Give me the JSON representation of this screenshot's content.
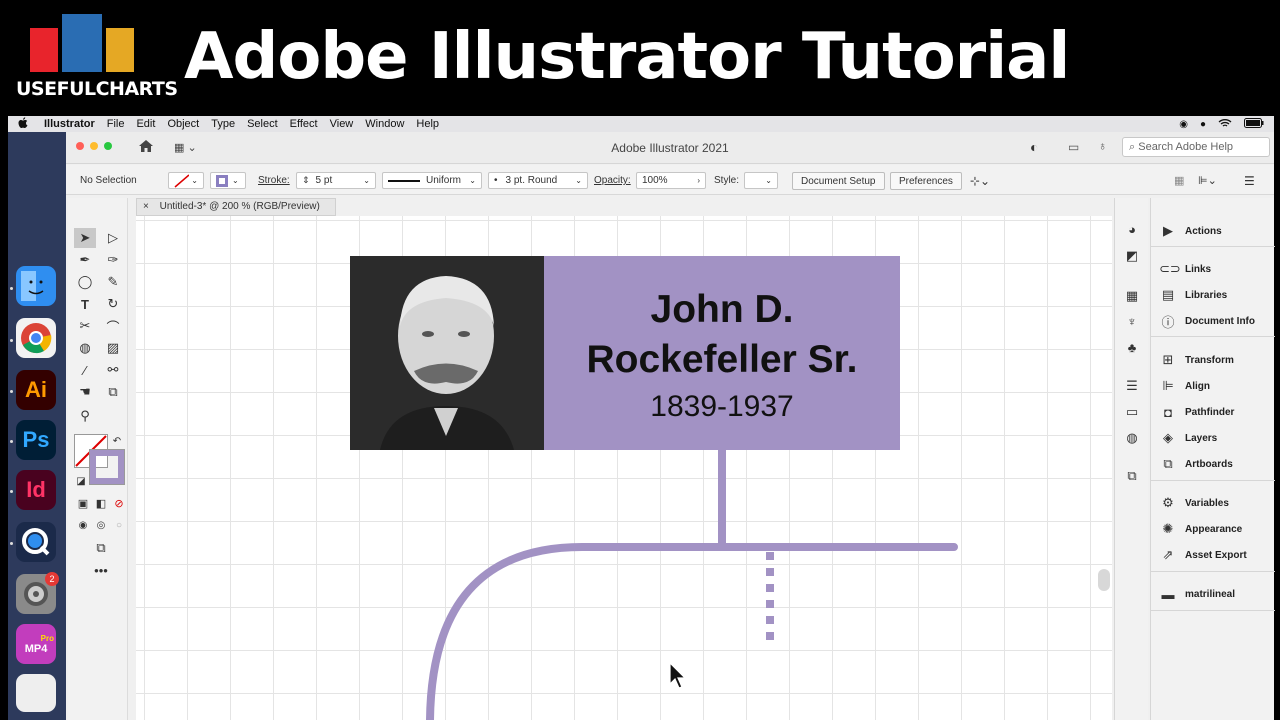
{
  "banner": {
    "logo_text": "USEFULCHARTS",
    "title": "Adobe Illustrator Tutorial",
    "logo_colors": [
      "#e8242c",
      "#2a6db3",
      "#e5a824"
    ]
  },
  "menubar": {
    "apple": "",
    "items": [
      "Illustrator",
      "File",
      "Edit",
      "Object",
      "Type",
      "Select",
      "Effect",
      "View",
      "Window",
      "Help"
    ]
  },
  "dock": {
    "apps": [
      {
        "name": "Finder",
        "icon": "finder-icon",
        "color": "#2f8ef0"
      },
      {
        "name": "Chrome",
        "icon": "chrome-icon",
        "color": "#f2f2f2"
      },
      {
        "name": "Ai",
        "icon": "illustrator-icon",
        "color": "#330000"
      },
      {
        "name": "Ps",
        "icon": "photoshop-icon",
        "color": "#001e36"
      },
      {
        "name": "Id",
        "icon": "indesign-icon",
        "color": "#49021f"
      },
      {
        "name": "QuickTime",
        "icon": "quicktime-icon",
        "color": "#1b2a4a"
      },
      {
        "name": "System Preferences",
        "icon": "gear-icon",
        "color": "#8a8a8a",
        "badge": "2"
      },
      {
        "name": "MP4",
        "icon": "mp4-icon",
        "color": "#c23dbd",
        "sublabel": "Pro"
      },
      {
        "name": "Document",
        "icon": "document-icon",
        "color": "#eeeeee"
      }
    ]
  },
  "window": {
    "title": "Adobe Illustrator 2021",
    "search_placeholder": "Search Adobe Help"
  },
  "controlbar": {
    "selection": "No Selection",
    "stroke_label": "Stroke:",
    "stroke_value": "5 pt",
    "profile": "Uniform",
    "brush": "3 pt. Round",
    "opacity_label": "Opacity:",
    "opacity_value": "100%",
    "style_label": "Style:",
    "document_setup": "Document Setup",
    "preferences": "Preferences"
  },
  "document_tab": {
    "label": "Untitled-3* @ 200 % (RGB/Preview)",
    "close": "×"
  },
  "artwork": {
    "name_line1": "John D.",
    "name_line2": "Rockefeller Sr.",
    "dates": "1839-1937",
    "card_color": "#a292c4",
    "line_color": "#a292c4"
  },
  "panels": [
    {
      "label": "Actions",
      "icon": "play-icon"
    },
    {
      "label": "Links",
      "icon": "link-icon"
    },
    {
      "label": "Libraries",
      "icon": "libraries-icon"
    },
    {
      "label": "Document Info",
      "icon": "info-icon"
    },
    {
      "label": "Transform",
      "icon": "transform-icon"
    },
    {
      "label": "Align",
      "icon": "align-icon"
    },
    {
      "label": "Pathfinder",
      "icon": "pathfinder-icon"
    },
    {
      "label": "Layers",
      "icon": "layers-icon"
    },
    {
      "label": "Artboards",
      "icon": "artboards-icon"
    },
    {
      "label": "Variables",
      "icon": "variables-icon"
    },
    {
      "label": "Appearance",
      "icon": "appearance-icon"
    },
    {
      "label": "Asset Export",
      "icon": "export-icon"
    },
    {
      "label": "matrilineal",
      "icon": "folder-icon"
    }
  ]
}
